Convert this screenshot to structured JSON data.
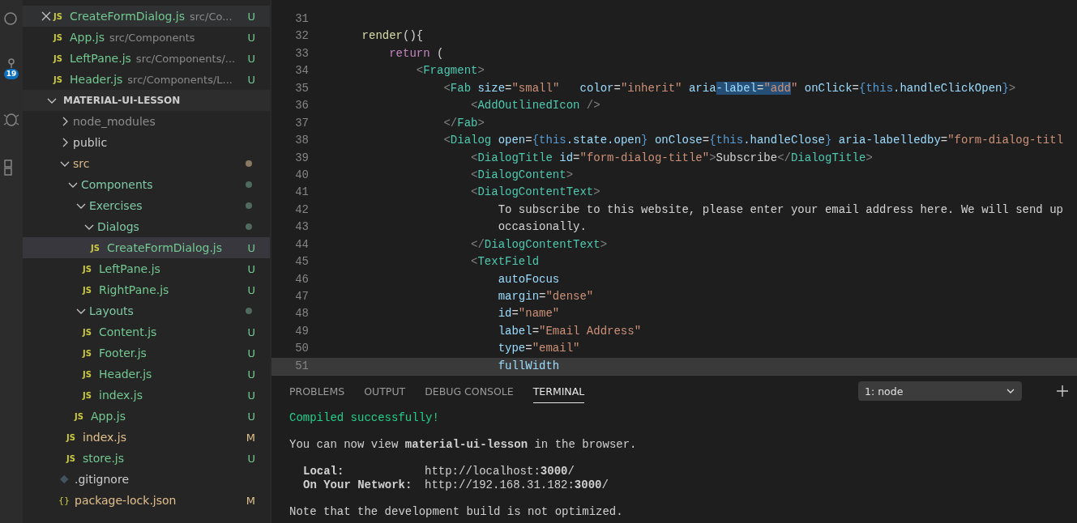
{
  "activity_bar": {
    "badge": "19"
  },
  "open_editors": [
    {
      "icon_text": "JS",
      "name": "CreateFormDialog.js",
      "path": "src/Co...",
      "status": "U",
      "hovered": true
    },
    {
      "icon_text": "JS",
      "name": "App.js",
      "path": "src/Components",
      "status": "U",
      "hovered": false
    },
    {
      "icon_text": "JS",
      "name": "LeftPane.js",
      "path": "src/Components/...",
      "status": "U",
      "hovered": false
    },
    {
      "icon_text": "JS",
      "name": "Header.js",
      "path": "src/Components/L...",
      "status": "U",
      "hovered": false
    }
  ],
  "explorer": {
    "title": "MATERIAL-UI-LESSON",
    "expanded": true,
    "items": [
      {
        "kind": "folder",
        "name": "node_modules",
        "expanded": false,
        "ignored": true,
        "selected": false
      },
      {
        "kind": "folder",
        "name": "public",
        "expanded": false,
        "selected": false
      },
      {
        "kind": "folder",
        "name": "src",
        "expanded": true,
        "color": "#8b7a62",
        "selected": false,
        "children": [
          {
            "kind": "folder",
            "name": "Components",
            "expanded": true,
            "color": "#4f6b5e",
            "selected": false,
            "children": [
              {
                "kind": "folder",
                "name": "Exercises",
                "expanded": true,
                "color": "#4f6b5e",
                "selected": false,
                "children": [
                  {
                    "kind": "folder",
                    "name": "Dialogs",
                    "expanded": true,
                    "color": "#4f6b5e",
                    "selected": false,
                    "children": [
                      {
                        "kind": "js",
                        "icon_text": "JS",
                        "name": "CreateFormDialog.js",
                        "status": "U",
                        "selected": true
                      }
                    ]
                  },
                  {
                    "kind": "js",
                    "icon_text": "JS",
                    "name": "LeftPane.js",
                    "status": "U",
                    "selected": false
                  },
                  {
                    "kind": "js",
                    "icon_text": "JS",
                    "name": "RightPane.js",
                    "status": "U",
                    "selected": false
                  }
                ]
              },
              {
                "kind": "folder",
                "name": "Layouts",
                "expanded": true,
                "color": "#4f6b5e",
                "selected": false,
                "children": [
                  {
                    "kind": "js",
                    "icon_text": "JS",
                    "name": "Content.js",
                    "status": "U",
                    "selected": false
                  },
                  {
                    "kind": "js",
                    "icon_text": "JS",
                    "name": "Footer.js",
                    "status": "U",
                    "selected": false
                  },
                  {
                    "kind": "js",
                    "icon_text": "JS",
                    "name": "Header.js",
                    "status": "U",
                    "selected": false
                  },
                  {
                    "kind": "js",
                    "icon_text": "JS",
                    "name": "index.js",
                    "status": "U",
                    "selected": false
                  }
                ]
              },
              {
                "kind": "js",
                "icon_text": "JS",
                "name": "App.js",
                "status": "U",
                "selected": false
              }
            ]
          },
          {
            "kind": "js",
            "icon_text": "JS",
            "name": "index.js",
            "status": "M",
            "selected": false
          },
          {
            "kind": "js",
            "icon_text": "JS",
            "name": "store.js",
            "status": "U",
            "selected": false
          }
        ]
      },
      {
        "kind": "git",
        "name": ".gitignore",
        "selected": false
      },
      {
        "kind": "json",
        "icon_text": "{}",
        "name": "package-lock.json",
        "status": "M",
        "selected": false
      }
    ]
  },
  "editor": {
    "lines": [
      {
        "number": "31",
        "current": false
      },
      {
        "number": "32",
        "current": false,
        "tokens": [
          {
            "kind": "fn",
            "t": "    render"
          },
          {
            "kind": "punct",
            "t": "(){"
          }
        ]
      },
      {
        "number": "33",
        "current": false,
        "tokens": [
          {
            "kind": "kw",
            "t": "        return"
          },
          {
            "kind": "punct",
            "t": " ("
          }
        ]
      },
      {
        "number": "34",
        "current": false,
        "tokens": [
          {
            "kind": "bracket",
            "t": "            <"
          },
          {
            "kind": "tag",
            "t": "Fragment"
          },
          {
            "kind": "bracket",
            "t": ">"
          }
        ]
      },
      {
        "number": "35",
        "current": false,
        "tokens": [
          {
            "kind": "bracket",
            "t": "                <",
            "selected": false
          },
          {
            "kind": "tag",
            "t": "Fab",
            "selected": false
          },
          {
            "kind": "attr",
            "t": " size",
            "selected": false
          },
          {
            "kind": "punct",
            "t": "=",
            "selected": false
          },
          {
            "kind": "str",
            "t": "\"small\"",
            "selected": false
          },
          {
            "kind": "attr",
            "t": "   color",
            "selected": false
          },
          {
            "kind": "punct",
            "t": "=",
            "selected": false
          },
          {
            "kind": "str",
            "t": "\"inherit\"",
            "selected": false
          },
          {
            "kind": "attr",
            "t": " aria",
            "selected": false
          },
          {
            "kind": "attr",
            "t": "-label",
            "selected": true
          },
          {
            "kind": "punct",
            "t": "=",
            "selected": true
          },
          {
            "kind": "str",
            "t": "\"add",
            "selected": true
          },
          {
            "kind": "str",
            "t": "\"",
            "selected": false
          },
          {
            "kind": "attr",
            "t": " onClick",
            "selected": false
          },
          {
            "kind": "punct",
            "t": "=",
            "selected": false
          },
          {
            "kind": "brace",
            "t": "{",
            "selected": false
          },
          {
            "kind": "this",
            "t": "this",
            "selected": false
          },
          {
            "kind": "prop",
            "t": ".handleClickOpen",
            "selected": false
          },
          {
            "kind": "brace",
            "t": "}",
            "selected": false
          },
          {
            "kind": "bracket",
            "t": ">",
            "selected": false
          }
        ]
      },
      {
        "number": "36",
        "current": false,
        "tokens": [
          {
            "kind": "bracket",
            "t": "                    <"
          },
          {
            "kind": "tag",
            "t": "AddOutlinedIcon"
          },
          {
            "kind": "bracket",
            "t": " />"
          }
        ]
      },
      {
        "number": "37",
        "current": false,
        "tokens": [
          {
            "kind": "bracket",
            "t": "                </"
          },
          {
            "kind": "tag",
            "t": "Fab"
          },
          {
            "kind": "bracket",
            "t": ">"
          }
        ]
      },
      {
        "number": "38",
        "current": false,
        "tokens": [
          {
            "kind": "bracket",
            "t": "                <"
          },
          {
            "kind": "tag",
            "t": "Dialog"
          },
          {
            "kind": "attr",
            "t": " open"
          },
          {
            "kind": "punct",
            "t": "="
          },
          {
            "kind": "brace",
            "t": "{"
          },
          {
            "kind": "this",
            "t": "this"
          },
          {
            "kind": "prop",
            "t": ".state.open"
          },
          {
            "kind": "brace",
            "t": "}"
          },
          {
            "kind": "attr",
            "t": " onClose"
          },
          {
            "kind": "punct",
            "t": "="
          },
          {
            "kind": "brace",
            "t": "{"
          },
          {
            "kind": "this",
            "t": "this"
          },
          {
            "kind": "prop",
            "t": ".handleClose"
          },
          {
            "kind": "brace",
            "t": "}"
          },
          {
            "kind": "attr",
            "t": " aria-labelledby"
          },
          {
            "kind": "punct",
            "t": "="
          },
          {
            "kind": "str",
            "t": "\"form-dialog-titl"
          }
        ]
      },
      {
        "number": "39",
        "current": false,
        "tokens": [
          {
            "kind": "bracket",
            "t": "                    <"
          },
          {
            "kind": "tag",
            "t": "DialogTitle"
          },
          {
            "kind": "attr",
            "t": " id"
          },
          {
            "kind": "punct",
            "t": "="
          },
          {
            "kind": "str",
            "t": "\"form-dialog-title\""
          },
          {
            "kind": "bracket",
            "t": ">"
          },
          {
            "kind": "text",
            "t": "Subscribe"
          },
          {
            "kind": "bracket",
            "t": "</"
          },
          {
            "kind": "tag",
            "t": "DialogTitle"
          },
          {
            "kind": "bracket",
            "t": ">"
          }
        ]
      },
      {
        "number": "40",
        "current": false,
        "tokens": [
          {
            "kind": "bracket",
            "t": "                    <"
          },
          {
            "kind": "tag",
            "t": "DialogContent"
          },
          {
            "kind": "bracket",
            "t": ">"
          }
        ]
      },
      {
        "number": "41",
        "current": false,
        "tokens": [
          {
            "kind": "bracket",
            "t": "                    <"
          },
          {
            "kind": "tag",
            "t": "DialogContentText"
          },
          {
            "kind": "bracket",
            "t": ">"
          }
        ]
      },
      {
        "number": "42",
        "current": false,
        "tokens": [
          {
            "kind": "text",
            "t": "                        To subscribe to this website, please enter your email address here. We will send up"
          }
        ]
      },
      {
        "number": "43",
        "current": false,
        "tokens": [
          {
            "kind": "text",
            "t": "                        occasionally."
          }
        ]
      },
      {
        "number": "44",
        "current": false,
        "tokens": [
          {
            "kind": "bracket",
            "t": "                    </"
          },
          {
            "kind": "tag",
            "t": "DialogContentText"
          },
          {
            "kind": "bracket",
            "t": ">"
          }
        ]
      },
      {
        "number": "45",
        "current": false,
        "tokens": [
          {
            "kind": "bracket",
            "t": "                    <"
          },
          {
            "kind": "tag",
            "t": "TextField"
          }
        ]
      },
      {
        "number": "46",
        "current": false,
        "tokens": [
          {
            "kind": "attr",
            "t": "                        autoFocus"
          }
        ]
      },
      {
        "number": "47",
        "current": false,
        "tokens": [
          {
            "kind": "attr",
            "t": "                        margin"
          },
          {
            "kind": "punct",
            "t": "="
          },
          {
            "kind": "str",
            "t": "\"dense\""
          }
        ]
      },
      {
        "number": "48",
        "current": false,
        "tokens": [
          {
            "kind": "attr",
            "t": "                        id"
          },
          {
            "kind": "punct",
            "t": "="
          },
          {
            "kind": "str",
            "t": "\"name\""
          }
        ]
      },
      {
        "number": "49",
        "current": false,
        "tokens": [
          {
            "kind": "attr",
            "t": "                        label"
          },
          {
            "kind": "punct",
            "t": "="
          },
          {
            "kind": "str",
            "t": "\"Email Address\""
          }
        ]
      },
      {
        "number": "50",
        "current": false,
        "tokens": [
          {
            "kind": "attr",
            "t": "                        type"
          },
          {
            "kind": "punct",
            "t": "="
          },
          {
            "kind": "str",
            "t": "\"email\""
          }
        ]
      },
      {
        "number": "51",
        "current": true,
        "tokens": [
          {
            "kind": "attr",
            "t": "                        fullWidth"
          }
        ]
      }
    ]
  },
  "panel": {
    "tabs": [
      {
        "label": "PROBLEMS",
        "selected": false
      },
      {
        "label": "OUTPUT",
        "selected": false
      },
      {
        "label": "DEBUG CONSOLE",
        "selected": false
      },
      {
        "label": "TERMINAL",
        "selected": true
      }
    ],
    "terminal_select": {
      "value": "1: node"
    },
    "terminal": [
      [
        {
          "kind": "success",
          "text": "Compiled successfully!"
        }
      ],
      [
        {
          "kind": "text",
          "text": "You can now view **material-ui-lesson** in the browser."
        }
      ],
      [
        {
          "kind": "address",
          "label": "Local:",
          "text": "http://localhost:**3000**/"
        },
        {
          "kind": "address",
          "label": "On Your Network:",
          "text": "http://192.168.31.182:**3000**/"
        }
      ],
      [
        {
          "kind": "text",
          "text": "Note that the development build is not optimized."
        }
      ]
    ]
  }
}
